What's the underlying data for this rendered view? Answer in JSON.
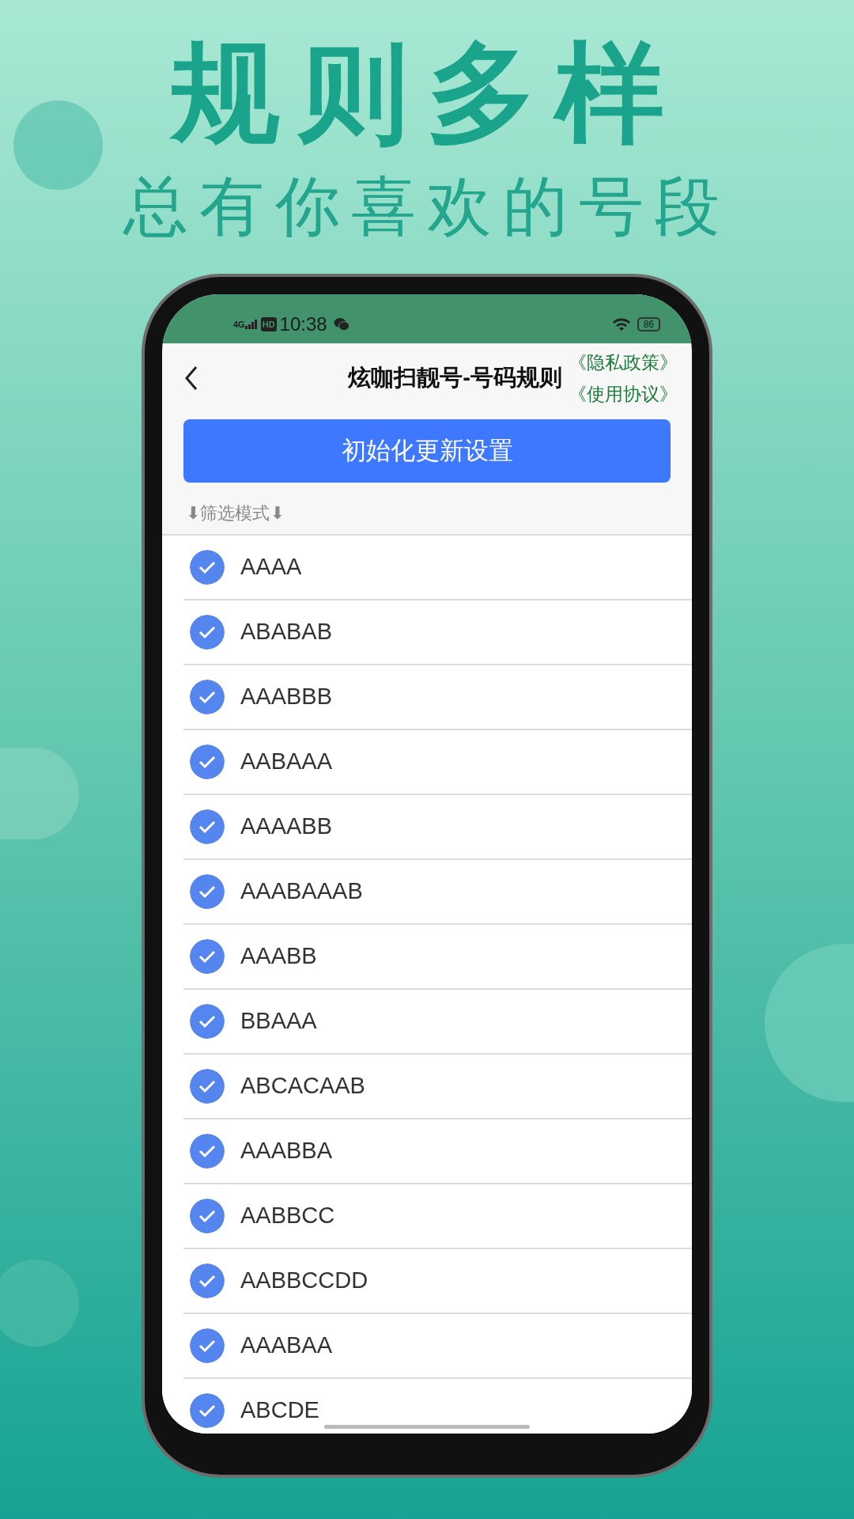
{
  "headline": "规则多样",
  "subheadline": "总有你喜欢的号段",
  "status_bar": {
    "network": "4G",
    "hd": "HD",
    "time": "10:38",
    "battery": "86"
  },
  "header": {
    "title": "炫咖扫靓号-号码规则",
    "links": [
      "《隐私政策》",
      "《使用协议》"
    ]
  },
  "reset_button": "初始化更新设置",
  "section_label": "⬇筛选模式⬇",
  "rules": [
    {
      "label": "AAAA",
      "checked": true
    },
    {
      "label": "ABABAB",
      "checked": true
    },
    {
      "label": "AAABBB",
      "checked": true
    },
    {
      "label": "AABAAA",
      "checked": true
    },
    {
      "label": "AAAABB",
      "checked": true
    },
    {
      "label": "AAABAAAB",
      "checked": true
    },
    {
      "label": "AAABB",
      "checked": true
    },
    {
      "label": "BBAAA",
      "checked": true
    },
    {
      "label": "ABCACAAB",
      "checked": true
    },
    {
      "label": "AAABBA",
      "checked": true
    },
    {
      "label": "AABBCC",
      "checked": true
    },
    {
      "label": "AABBCCDD",
      "checked": true
    },
    {
      "label": "AAABAA",
      "checked": true
    },
    {
      "label": "ABCDE",
      "checked": true
    }
  ]
}
